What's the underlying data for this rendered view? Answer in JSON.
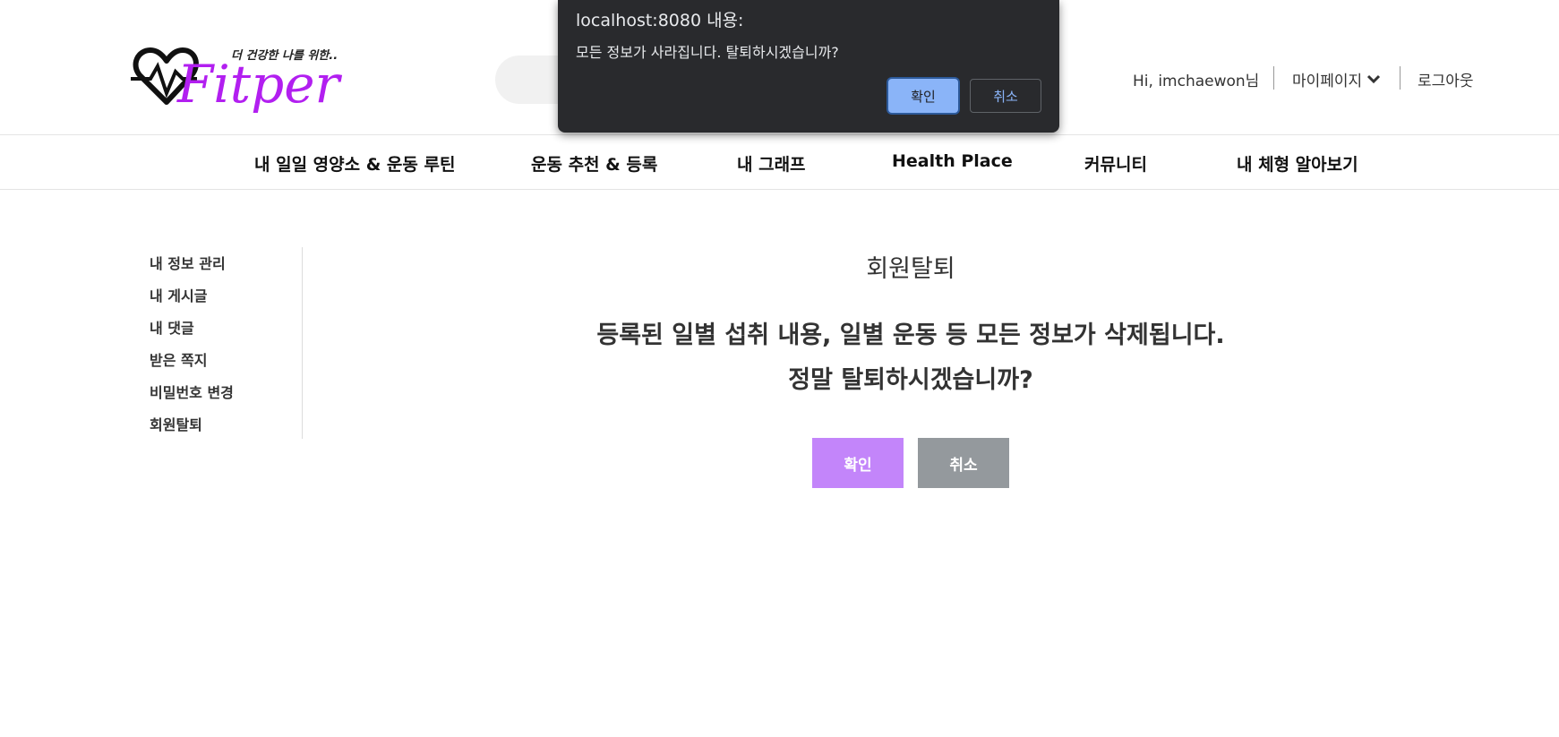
{
  "header": {
    "logo_tagline": "더 건강한 나를 위한..",
    "logo_text": "Fitper",
    "greeting": "Hi, imchaewon님",
    "mypage_label": "마이페이지",
    "logout_label": "로그아웃"
  },
  "menu": {
    "items": [
      {
        "label": "내 일일 영양소 & 운동 루틴"
      },
      {
        "label": "운동 추천 & 등록"
      },
      {
        "label": "내 그래프"
      },
      {
        "label": "Health Place"
      },
      {
        "label": "커뮤니티"
      },
      {
        "label": "내 체형 알아보기"
      }
    ]
  },
  "sidebar": {
    "items": [
      {
        "label": "내 정보 관리"
      },
      {
        "label": "내 게시글"
      },
      {
        "label": "내 댓글"
      },
      {
        "label": "받은 쪽지"
      },
      {
        "label": "비밀번호 변경"
      },
      {
        "label": "회원탈퇴"
      }
    ]
  },
  "content": {
    "title": "회원탈퇴",
    "warning_line1": "등록된 일별 섭취 내용, 일별 운동 등 모든 정보가 삭제됩니다.",
    "warning_line2": "정말 탈퇴하시겠습니까?",
    "confirm_label": "확인",
    "cancel_label": "취소"
  },
  "dialog": {
    "title": "localhost:8080 내용:",
    "message": "모든 정보가 사라집니다. 탈퇴하시겠습니까?",
    "ok_label": "확인",
    "cancel_label": "취소"
  },
  "colors": {
    "brand_purple": "#c385fa",
    "logo_purple": "#b21ff0",
    "cancel_gray": "#94999d",
    "dialog_bg": "#292a2d",
    "dialog_accent": "#8ab4f8"
  }
}
